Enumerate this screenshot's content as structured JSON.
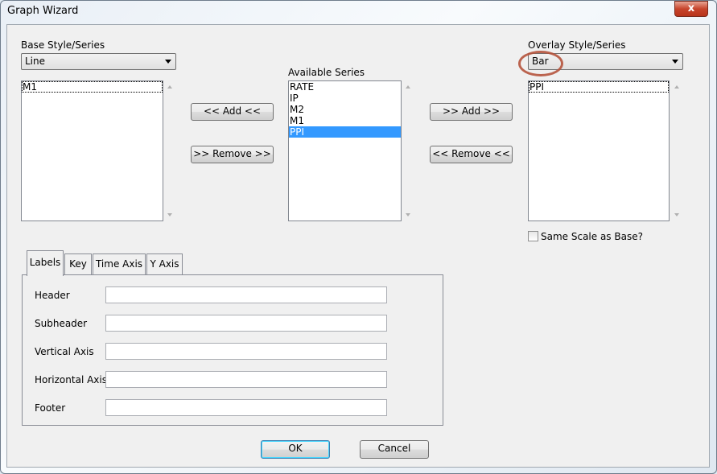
{
  "window": {
    "title": "Graph Wizard",
    "close_label": "x"
  },
  "base": {
    "label": "Base Style/Series",
    "style": "Line",
    "series": [
      "M1"
    ]
  },
  "available": {
    "label": "Available Series",
    "series": [
      "RATE",
      "IP",
      "M2",
      "M1",
      "PPI"
    ],
    "selected": "PPI"
  },
  "overlay": {
    "label": "Overlay Style/Series",
    "style": "Bar",
    "series": [
      "PPI"
    ],
    "same_scale_label": "Same Scale as Base?",
    "same_scale_checked": false,
    "highlight_color": "#b5533c"
  },
  "buttons": {
    "add_left": "<< Add <<",
    "remove_right": ">> Remove >>",
    "add_right": ">> Add >>",
    "remove_left": "<< Remove <<",
    "ok": "OK",
    "cancel": "Cancel"
  },
  "tabs": [
    {
      "label": "Labels",
      "active": true
    },
    {
      "label": "Key"
    },
    {
      "label": "Time Axis"
    },
    {
      "label": "Y Axis"
    }
  ],
  "fields": [
    {
      "label": "Header",
      "value": ""
    },
    {
      "label": "Subheader",
      "value": ""
    },
    {
      "label": "Vertical Axis",
      "value": ""
    },
    {
      "label": "Horizontal Axis",
      "value": ""
    },
    {
      "label": "Footer",
      "value": ""
    }
  ],
  "colors": {
    "selection": "#3399ff",
    "close": "#c7452c"
  }
}
